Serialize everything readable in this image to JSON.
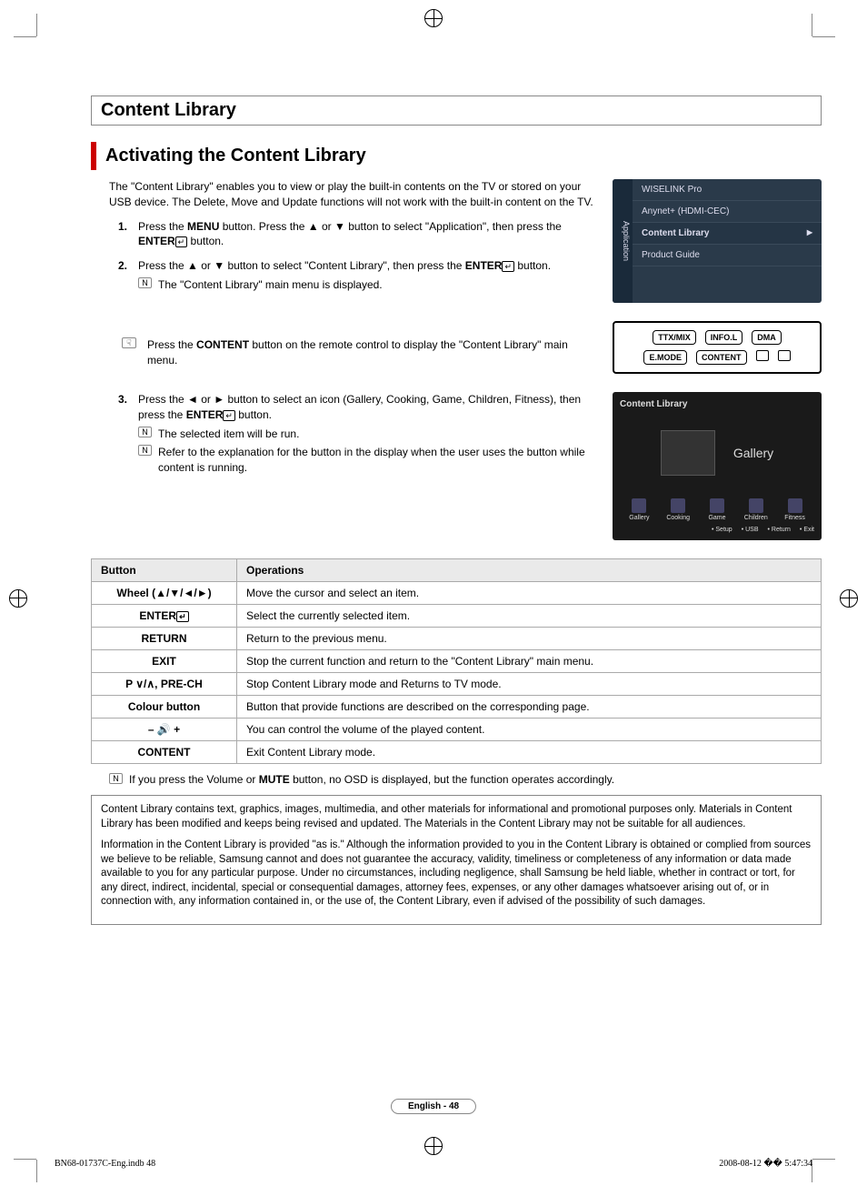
{
  "header": {
    "section": "Content Library",
    "subsection": "Activating the Content Library"
  },
  "intro": "The \"Content Library\" enables you to view or play the built-in contents on the TV or stored on your USB device. The Delete, Move and Update functions will not work with the built-in content on the TV.",
  "steps": {
    "s1_pre": "Press the ",
    "s1_menu": "MENU",
    "s1_mid": " button. Press the ▲ or ▼ button to select \"Application\", then press the  ",
    "s1_enter": "ENTER",
    "s1_post": " button.",
    "s2_pre": "Press the ▲ or ▼ button to select \"Content Library\", then press the ",
    "s2_enter": "ENTER",
    "s2_post": " button.",
    "s2_note": "The \"Content Library\" main menu is displayed.",
    "remote_pre": "Press the ",
    "remote_btn": "CONTENT",
    "remote_post": " button on the remote control to display the \"Content Library\" main menu.",
    "s3_pre": "Press the ◄ or ► button to select an icon (Gallery, Cooking, Game, Children, Fitness), then press the  ",
    "s3_enter": "ENTER",
    "s3_post": " button.",
    "s3_note1": "The selected item will be run.",
    "s3_note2": "Refer to the explanation for the button in the display when the user uses the button while content is running."
  },
  "osd": {
    "tab": "Application",
    "items": [
      "WISELINK Pro",
      "Anynet+ (HDMI-CEC)",
      "Content Library",
      "Product Guide"
    ],
    "selected_index": 2
  },
  "remote_buttons": {
    "r1a": "TTX/MIX",
    "r1b": "INFO.L",
    "r1c": "DMA",
    "r2a": "E.MODE",
    "r2b": "CONTENT"
  },
  "clib": {
    "title": "Content Library",
    "main_label": "Gallery",
    "cats": [
      "Gallery",
      "Cooking",
      "Game",
      "Children",
      "Fitness"
    ],
    "footer": [
      "Setup",
      "USB",
      "Return",
      "Exit"
    ]
  },
  "table": {
    "h1": "Button",
    "h2": "Operations",
    "rows": [
      {
        "b": "Wheel (▲/▼/◄/►)",
        "o": "Move the cursor and select an item."
      },
      {
        "b": "ENTER",
        "o": "Select the currently selected item."
      },
      {
        "b": "RETURN",
        "o": "Return to the previous menu."
      },
      {
        "b": "EXIT",
        "o": "Stop the current function and return to the \"Content Library\" main menu."
      },
      {
        "b": "P ∨/∧, PRE-CH",
        "o": "Stop Content Library mode and Returns to TV mode."
      },
      {
        "b": "Colour button",
        "o": "Button that provide functions are described on the corresponding page."
      },
      {
        "b": "– 🔊 +",
        "o": "You can control the volume of the played content."
      },
      {
        "b": "CONTENT",
        "o": "Exit Content Library mode."
      }
    ]
  },
  "volnote_pre": "If you press the Volume or ",
  "volnote_b": "MUTE",
  "volnote_post": " button, no OSD is displayed, but the function operates accordingly.",
  "legal": {
    "p1": "Content Library contains text, graphics, images, multimedia, and other materials for informational and promotional purposes only. Materials in Content Library has been modified and keeps being revised and updated.  The Materials in the Content Library may not be suitable for all audiences.",
    "p2": "Information in the Content Library is provided \"as is.\" Although the information provided to you in the Content Library is obtained or complied from sources we believe to be reliable, Samsung cannot and does not guarantee the accuracy, validity, timeliness or completeness of any information or data made available to you for any particular purpose. Under no circumstances, including negligence, shall Samsung be held liable, whether in contract or tort, for any direct, indirect, incidental, special or consequential damages, attorney fees, expenses, or any other damages whatsoever arising out of, or in connection with, any information contained in, or the use of, the Content Library, even if advised of the possibility of such damages."
  },
  "pagefoot": "English - 48",
  "printfoot": {
    "left": "BN68-01737C-Eng.indb   48",
    "right": "2008-08-12   �� 5:47:34"
  }
}
